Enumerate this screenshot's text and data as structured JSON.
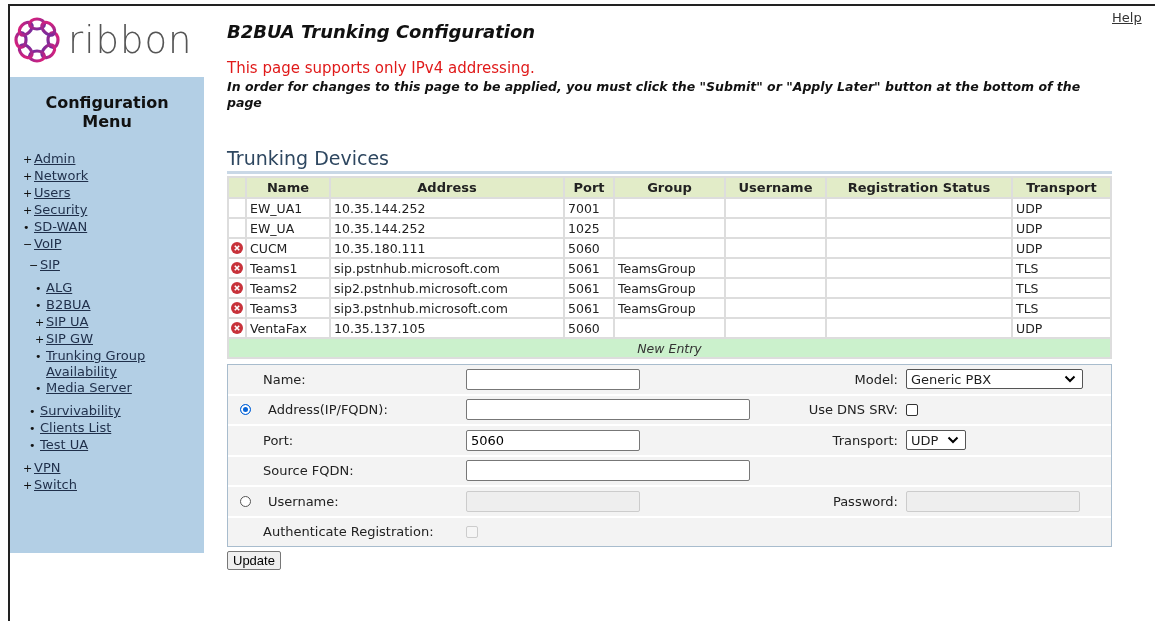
{
  "logo": {
    "text": "ribbon"
  },
  "help_link": "Help",
  "page_title": "B2BUA Trunking Configuration",
  "ipv4_notice": "This page supports only IPv4 addressing.",
  "instruction": "In order for changes to this page to be applied, you must click the \"Submit\" or \"Apply Later\" button at the bottom of the page",
  "sidebar": {
    "title": "Configuration Menu",
    "items": [
      {
        "marker": "+",
        "label": "Admin"
      },
      {
        "marker": "+",
        "label": "Network"
      },
      {
        "marker": "+",
        "label": "Users"
      },
      {
        "marker": "+",
        "label": "Security"
      },
      {
        "marker": "•",
        "label": "SD-WAN"
      },
      {
        "marker": "−",
        "label": "VoIP",
        "children": [
          {
            "marker": "−",
            "label": "SIP",
            "children": [
              {
                "marker": "•",
                "label": "ALG"
              },
              {
                "marker": "•",
                "label": "B2BUA"
              },
              {
                "marker": "+",
                "label": "SIP UA"
              },
              {
                "marker": "+",
                "label": "SIP GW"
              },
              {
                "marker": "•",
                "label": "Trunking Group Availability"
              },
              {
                "marker": "•",
                "label": "Media Server"
              }
            ]
          },
          {
            "marker": "•",
            "label": "Survivability"
          },
          {
            "marker": "•",
            "label": "Clients List"
          },
          {
            "marker": "•",
            "label": "Test UA"
          }
        ]
      },
      {
        "marker": "+",
        "label": "VPN"
      },
      {
        "marker": "+",
        "label": "Switch"
      }
    ]
  },
  "section_title": "Trunking Devices",
  "table": {
    "columns": [
      "Name",
      "Address",
      "Port",
      "Group",
      "Username",
      "Registration Status",
      "Transport"
    ],
    "rows": [
      {
        "error": false,
        "cells": [
          "EW_UA1",
          "10.35.144.252",
          "7001",
          "",
          "",
          "",
          "UDP"
        ]
      },
      {
        "error": false,
        "cells": [
          "EW_UA",
          "10.35.144.252",
          "1025",
          "",
          "",
          "",
          "UDP"
        ]
      },
      {
        "error": true,
        "cells": [
          "CUCM",
          "10.35.180.111",
          "5060",
          "",
          "",
          "",
          "UDP"
        ]
      },
      {
        "error": true,
        "cells": [
          "Teams1",
          "sip.pstnhub.microsoft.com",
          "5061",
          "TeamsGroup",
          "",
          "",
          "TLS"
        ]
      },
      {
        "error": true,
        "cells": [
          "Teams2",
          "sip2.pstnhub.microsoft.com",
          "5061",
          "TeamsGroup",
          "",
          "",
          "TLS"
        ]
      },
      {
        "error": true,
        "cells": [
          "Teams3",
          "sip3.pstnhub.microsoft.com",
          "5061",
          "TeamsGroup",
          "",
          "",
          "TLS"
        ]
      },
      {
        "error": true,
        "cells": [
          "VentaFax",
          "10.35.137.105",
          "5060",
          "",
          "",
          "",
          "UDP"
        ]
      }
    ],
    "new_entry": "New Entry"
  },
  "form": {
    "rows": [
      {
        "label": "Name:",
        "control": {
          "kind": "text",
          "disabled": false
        },
        "right_label": "Model:",
        "right_control": {
          "kind": "select",
          "value": "Generic PBX",
          "disabled": false
        }
      },
      {
        "radio": {
          "selected": true
        },
        "label": "Address(IP/FQDN):",
        "control": {
          "kind": "wide-text",
          "disabled": false
        },
        "right_label": "Use DNS SRV:",
        "right_control": {
          "kind": "checkbox",
          "checked": false,
          "disabled": false
        }
      },
      {
        "label": "Port:",
        "control": {
          "kind": "text",
          "value": "5060",
          "disabled": false
        },
        "right_label": "Transport:",
        "right_control": {
          "kind": "small-select",
          "value": "UDP",
          "disabled": false
        }
      },
      {
        "label": "Source FQDN:",
        "control": {
          "kind": "wide-text",
          "disabled": false
        }
      },
      {
        "radio": {
          "selected": false
        },
        "label": "Username:",
        "control": {
          "kind": "text",
          "disabled": true
        },
        "right_label": "Password:",
        "right_control": {
          "kind": "text",
          "disabled": true
        }
      },
      {
        "label": "Authenticate Registration:",
        "control": {
          "kind": "checkbox",
          "checked": false,
          "disabled": true
        }
      }
    ]
  },
  "update_button": "Update"
}
